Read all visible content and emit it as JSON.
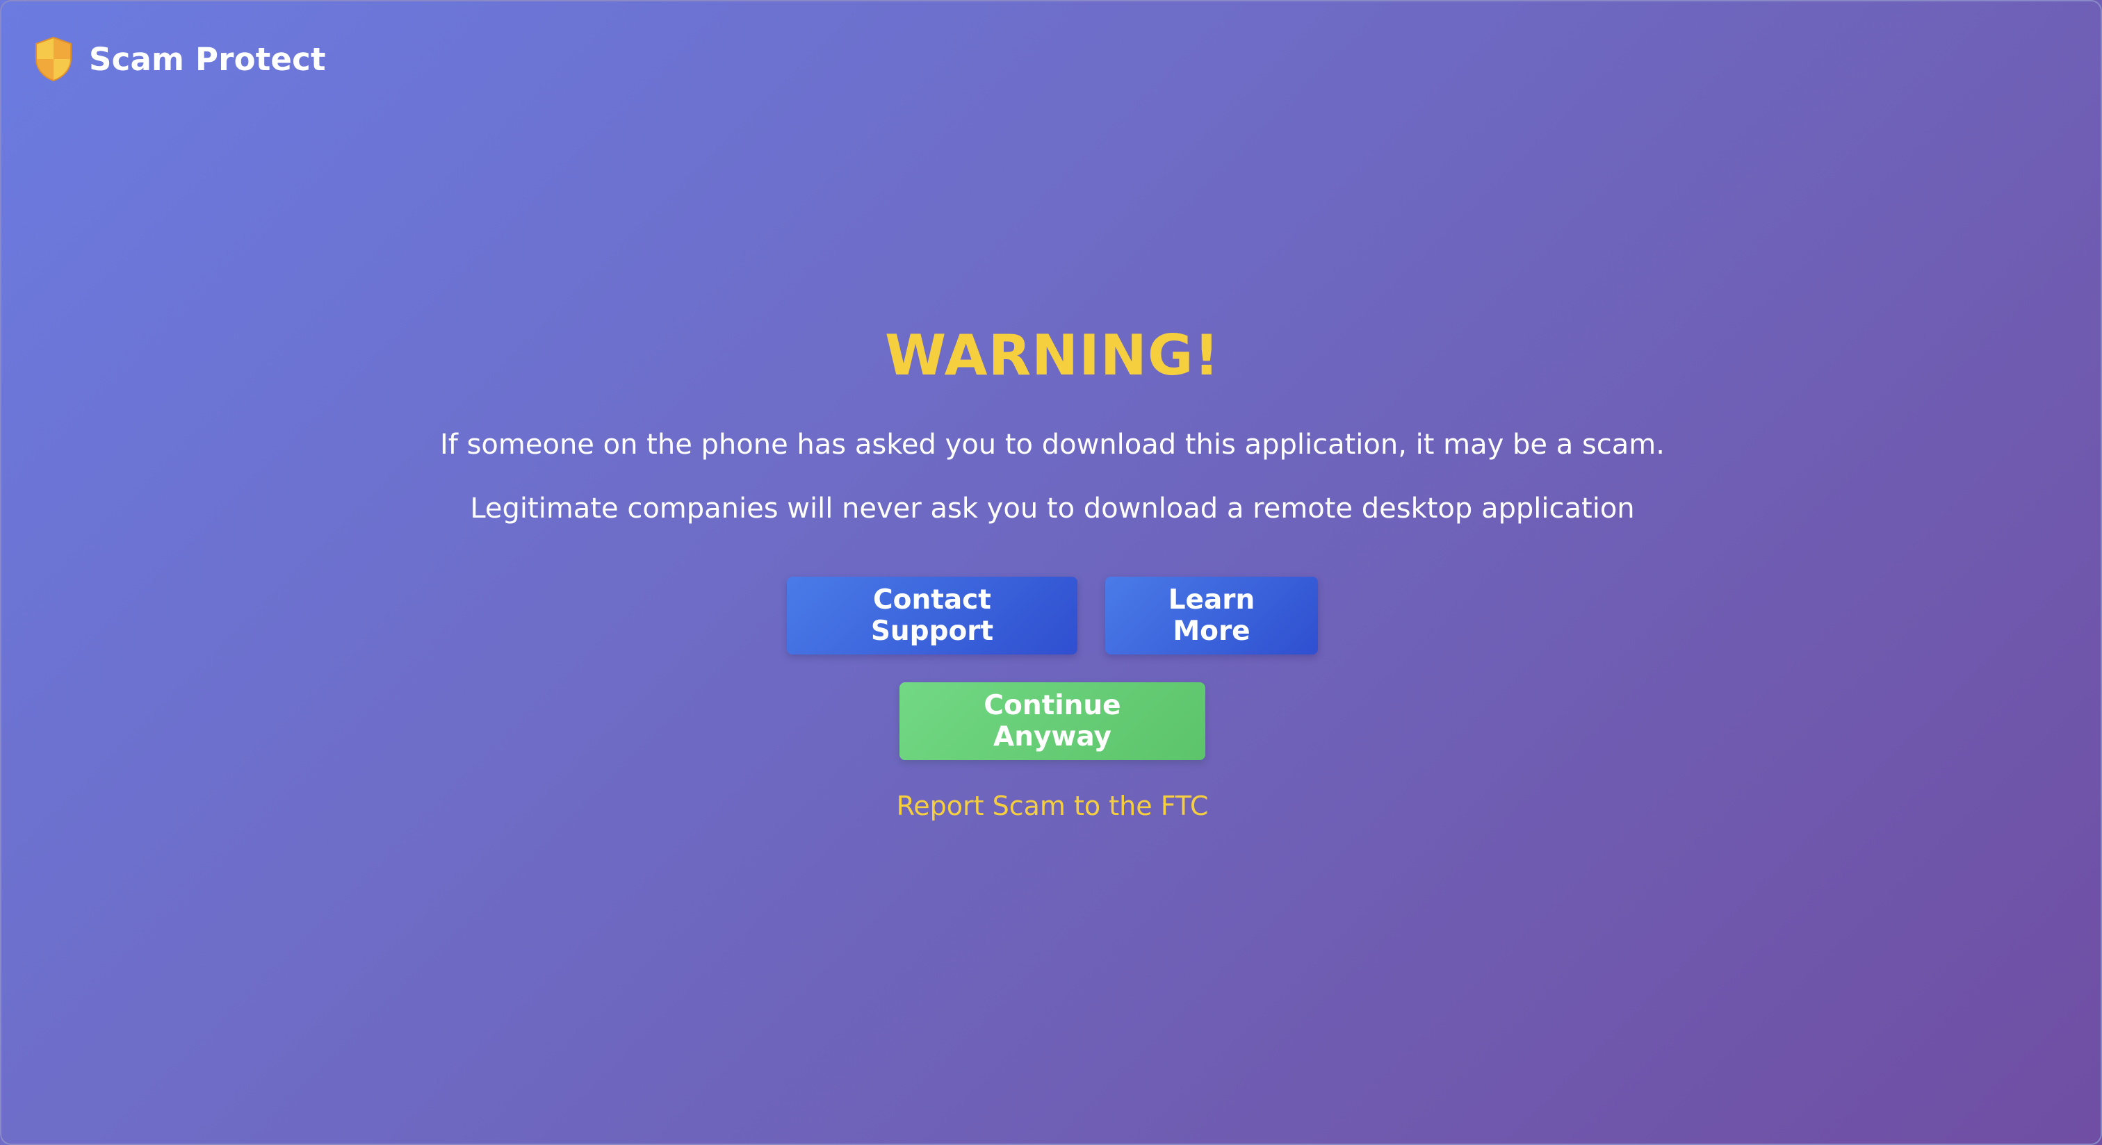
{
  "app": {
    "name": "Scam Protect",
    "logo_icon": "shield-icon"
  },
  "colors": {
    "accent_yellow": "#f6cf3f",
    "button_blue": "#3b5fdc",
    "button_green": "#66cf77",
    "background_start": "#6b7be0",
    "background_end": "#6f4ea3"
  },
  "warning": {
    "title": "WARNING!",
    "line1": "If someone on the phone has asked you to download this application, it may be a scam.",
    "line2": "Legitimate companies will never ask you to download a remote desktop application"
  },
  "actions": {
    "contact_support": "Contact Support",
    "learn_more": "Learn More",
    "continue_anyway": "Continue Anyway",
    "report_link": "Report Scam to the FTC"
  }
}
